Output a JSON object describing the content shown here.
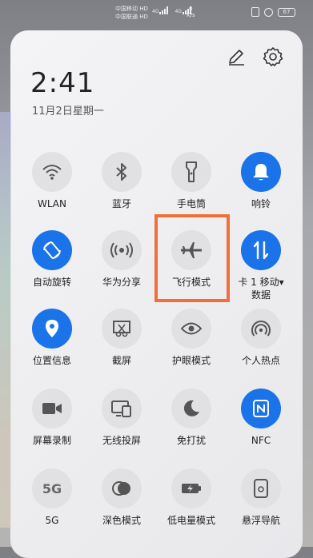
{
  "status_bar": {
    "carrier_1": "中国移动",
    "carrier_1_tag": "HD",
    "carrier_2": "中国联通",
    "carrier_2_tag": "HD",
    "net_1": "4G",
    "net_2": "4G",
    "speed_value": "0",
    "speed_unit": "K/s",
    "battery": "67"
  },
  "header": {
    "time": "2:41",
    "date": "11月2日星期一"
  },
  "colors": {
    "accent_on": "#1a73e8",
    "tile_off": "#e1e1e4",
    "highlight_box": "#ef6f3b"
  },
  "tiles": [
    {
      "label": "WLAN",
      "icon": "wifi-icon",
      "active": false
    },
    {
      "label": "蓝牙",
      "icon": "bluetooth-icon",
      "active": false
    },
    {
      "label": "手电筒",
      "icon": "flashlight-icon",
      "active": false
    },
    {
      "label": "响铃",
      "icon": "bell-icon",
      "active": true
    },
    {
      "label": "自动旋转",
      "icon": "rotate-icon",
      "active": true
    },
    {
      "label": "华为分享",
      "icon": "share-icon",
      "active": false
    },
    {
      "label": "飞行模式",
      "icon": "airplane-icon",
      "active": false
    },
    {
      "label": "卡 1 移动▾",
      "label2": "数据",
      "icon": "mobile-data-icon",
      "active": true
    },
    {
      "label": "位置信息",
      "icon": "location-icon",
      "active": true
    },
    {
      "label": "截屏",
      "icon": "screenshot-icon",
      "active": false
    },
    {
      "label": "护眼模式",
      "icon": "eye-icon",
      "active": false
    },
    {
      "label": "个人热点",
      "icon": "hotspot-icon",
      "active": false
    },
    {
      "label": "屏幕录制",
      "icon": "screen-record-icon",
      "active": false
    },
    {
      "label": "无线投屏",
      "icon": "wireless-projection-icon",
      "active": false
    },
    {
      "label": "免打扰",
      "icon": "moon-icon",
      "active": false
    },
    {
      "label": "NFC",
      "icon": "nfc-icon",
      "active": true
    },
    {
      "label": "5G",
      "icon_text": "5G",
      "icon": "5g-icon",
      "active": false
    },
    {
      "label": "深色模式",
      "icon": "dark-mode-icon",
      "active": false
    },
    {
      "label": "低电量模式",
      "icon": "battery-saver-icon",
      "active": false
    },
    {
      "label": "悬浮导航",
      "icon": "floating-nav-icon",
      "active": false
    }
  ]
}
